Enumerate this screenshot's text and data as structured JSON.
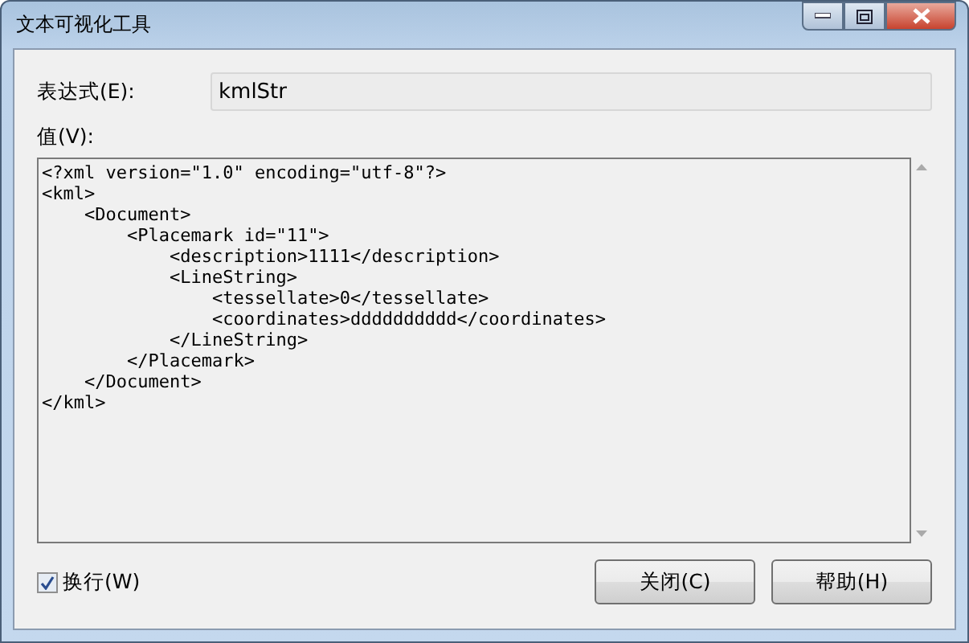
{
  "window": {
    "title": "文本可视化工具"
  },
  "expression": {
    "label": "表达式(E):",
    "value": "kmlStr"
  },
  "value_label": "值(V):",
  "value_lines": [
    "<?xml version=\"1.0\" encoding=\"utf-8\"?>",
    "<kml>",
    "    <Document>",
    "        <Placemark id=\"11\">",
    "            <description>1111</description>",
    "            <LineString>",
    "                <tessellate>0</tessellate>",
    "                <coordinates>dddddddddd</coordinates>",
    "            </LineString>",
    "        </Placemark>",
    "    </Document>",
    "</kml>"
  ],
  "wrap": {
    "label": "换行(W)",
    "checked": true
  },
  "buttons": [
    "关闭(C)",
    "帮助(H)"
  ]
}
